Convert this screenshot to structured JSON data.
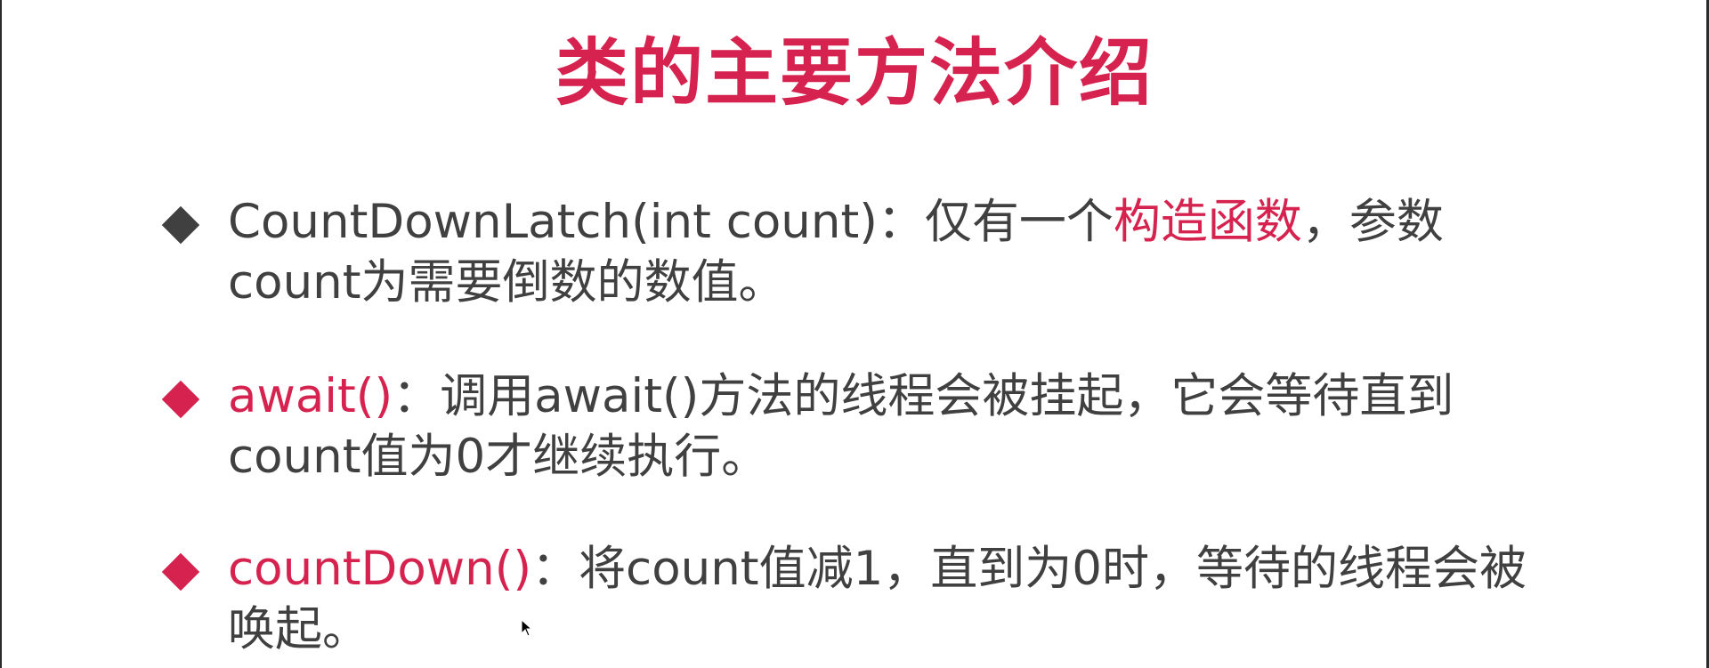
{
  "colors": {
    "accent": "#d6224e",
    "text": "#404040",
    "dark_marker": "#404040",
    "frame": "#2b2b2b"
  },
  "title": "类的主要方法介绍",
  "bullets": [
    {
      "marker_icon": "diamond-icon",
      "marker_color": "#404040",
      "lead": "CountDownLatch(int count)",
      "sep": "：",
      "before_highlight": "仅有一个",
      "highlight": "构造函数",
      "after_highlight": "，参数count为需要倒数的数值。"
    },
    {
      "marker_icon": "diamond-icon",
      "marker_color": "#d6224e",
      "lead": "await()",
      "sep": "：",
      "body": "调用await()方法的线程会被挂起，它会等待直到count值为0才继续执行。"
    },
    {
      "marker_icon": "diamond-icon",
      "marker_color": "#d6224e",
      "lead": "countDown()",
      "sep": "：",
      "body": "将count值减1，直到为0时，等待的线程会被唤起。"
    }
  ],
  "cursor_icon": "mouse-pointer-icon"
}
